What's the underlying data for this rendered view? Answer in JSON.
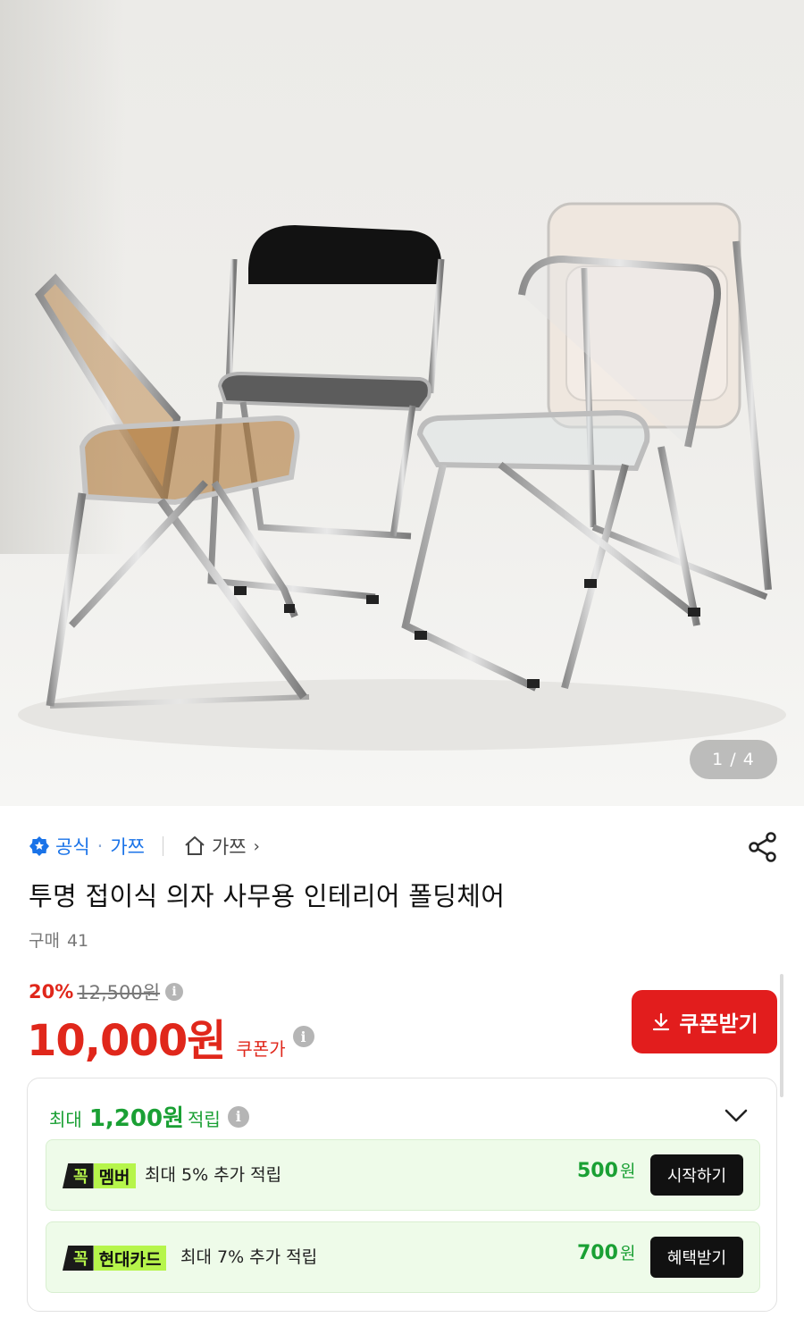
{
  "gallery": {
    "counter": "1 / 4",
    "image_description_icon": "folding-chairs-photo"
  },
  "seller": {
    "official_label": "공식",
    "dot": "·",
    "seller_name": "가쯔",
    "store_label": "가쯔",
    "chevron": "›"
  },
  "product": {
    "title": "투명 접이식 의자 사무용 인테리어 폴딩체어",
    "purchase_label": "구매",
    "purchase_count": "41"
  },
  "pricing": {
    "discount_rate": "20%",
    "original_price": "12,500원",
    "price": "10,000원",
    "coupon_price_label": "쿠폰가",
    "coupon_button": "쿠폰받기",
    "accent_color": "#e0271b"
  },
  "rewards": {
    "head_prefix": "최대",
    "head_amount": "1,200원",
    "head_suffix": "적립",
    "accent_color": "#1aa034",
    "items": [
      {
        "badge_k": "꼭",
        "badge_label": "멤버",
        "desc": "최대 5% 추가 적립",
        "amount": "500",
        "unit": "원",
        "button": "시작하기"
      },
      {
        "badge_k": "꼭",
        "badge_label": "현대카드",
        "desc": "최대 7% 추가 적립",
        "amount": "700",
        "unit": "원",
        "button": "혜택받기"
      }
    ]
  },
  "info_glyph": "i"
}
